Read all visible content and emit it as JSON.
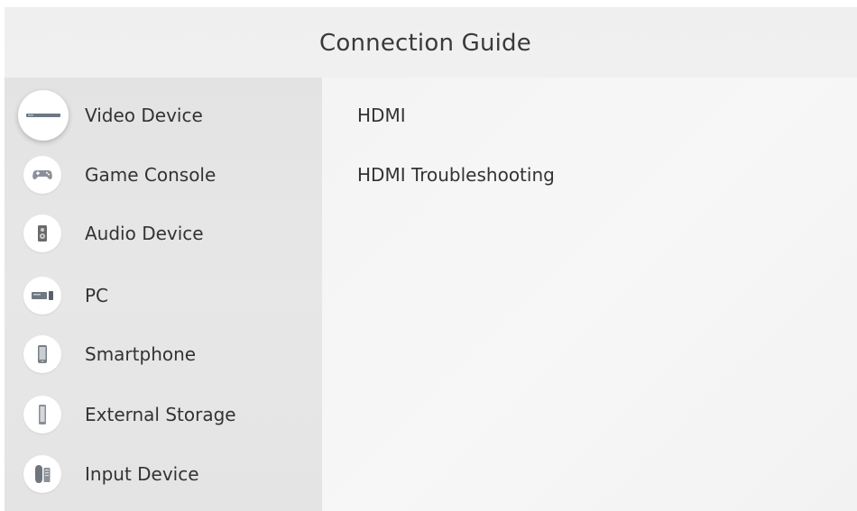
{
  "header": {
    "title": "Connection Guide"
  },
  "sidebar": {
    "items": [
      {
        "label": "Video Device",
        "icon": "video-device-icon",
        "selected": true
      },
      {
        "label": "Game Console",
        "icon": "game-console-icon",
        "selected": false
      },
      {
        "label": "Audio Device",
        "icon": "audio-device-icon",
        "selected": false
      },
      {
        "label": "PC",
        "icon": "pc-icon",
        "selected": false
      },
      {
        "label": "Smartphone",
        "icon": "smartphone-icon",
        "selected": false
      },
      {
        "label": "External Storage",
        "icon": "external-storage-icon",
        "selected": false
      },
      {
        "label": "Input Device",
        "icon": "input-device-icon",
        "selected": false
      }
    ]
  },
  "main": {
    "items": [
      {
        "label": "HDMI"
      },
      {
        "label": "HDMI Troubleshooting"
      }
    ]
  },
  "colors": {
    "header_bg": "#efefef",
    "sidebar_bg": "#e5e5e5",
    "content_bg": "#f5f5f5",
    "text": "#333333"
  }
}
